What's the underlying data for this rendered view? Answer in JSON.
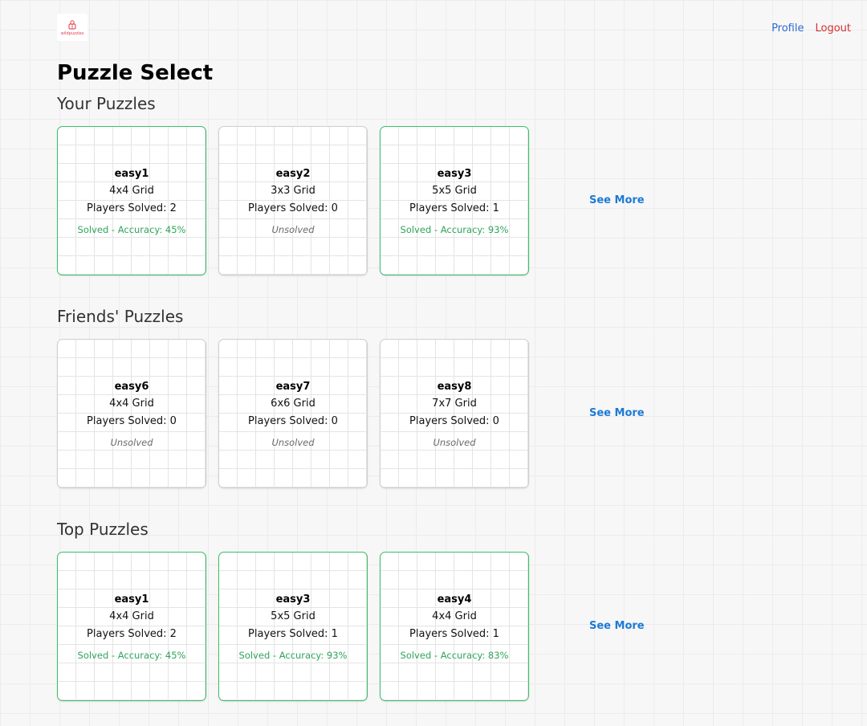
{
  "header": {
    "logo_text": "wildpuzzles",
    "nav": {
      "profile": "Profile",
      "logout": "Logout"
    }
  },
  "page_title": "Puzzle Select",
  "see_more_label": "See More",
  "colors": {
    "solved": "#2fa45a",
    "link": "#1d7ad6",
    "logout": "#d6302f",
    "profile": "#2e6bd6"
  },
  "sections": [
    {
      "title": "Your Puzzles",
      "puzzles": [
        {
          "name": "easy1",
          "grid": "4x4 Grid",
          "players": "Players Solved: 2",
          "status": "Solved - Accuracy: 45%",
          "solved": true
        },
        {
          "name": "easy2",
          "grid": "3x3 Grid",
          "players": "Players Solved: 0",
          "status": "Unsolved",
          "solved": false
        },
        {
          "name": "easy3",
          "grid": "5x5 Grid",
          "players": "Players Solved: 1",
          "status": "Solved - Accuracy: 93%",
          "solved": true
        }
      ]
    },
    {
      "title": "Friends' Puzzles",
      "puzzles": [
        {
          "name": "easy6",
          "grid": "4x4 Grid",
          "players": "Players Solved: 0",
          "status": "Unsolved",
          "solved": false
        },
        {
          "name": "easy7",
          "grid": "6x6 Grid",
          "players": "Players Solved: 0",
          "status": "Unsolved",
          "solved": false
        },
        {
          "name": "easy8",
          "grid": "7x7 Grid",
          "players": "Players Solved: 0",
          "status": "Unsolved",
          "solved": false
        }
      ]
    },
    {
      "title": "Top Puzzles",
      "puzzles": [
        {
          "name": "easy1",
          "grid": "4x4 Grid",
          "players": "Players Solved: 2",
          "status": "Solved - Accuracy: 45%",
          "solved": true
        },
        {
          "name": "easy3",
          "grid": "5x5 Grid",
          "players": "Players Solved: 1",
          "status": "Solved - Accuracy: 93%",
          "solved": true
        },
        {
          "name": "easy4",
          "grid": "4x4 Grid",
          "players": "Players Solved: 1",
          "status": "Solved - Accuracy: 83%",
          "solved": true
        }
      ]
    }
  ]
}
